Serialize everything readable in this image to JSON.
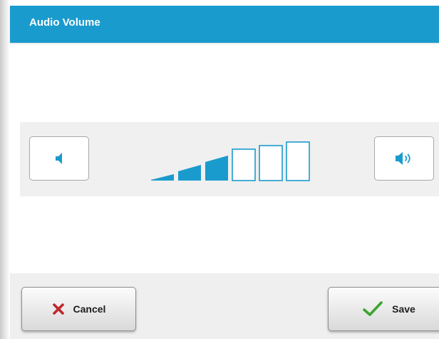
{
  "dialog": {
    "title": "Audio Volume"
  },
  "volume": {
    "level": 3,
    "max_level": 6,
    "decrease_icon": "speaker-low-icon",
    "increase_icon": "speaker-high-icon"
  },
  "footer": {
    "cancel_label": "Cancel",
    "cancel_icon": "x-icon",
    "save_label": "Save",
    "save_icon": "check-icon"
  },
  "colors": {
    "accent": "#1a9bcd",
    "cancel_x": "#c0262c",
    "save_check": "#3aa52f"
  }
}
